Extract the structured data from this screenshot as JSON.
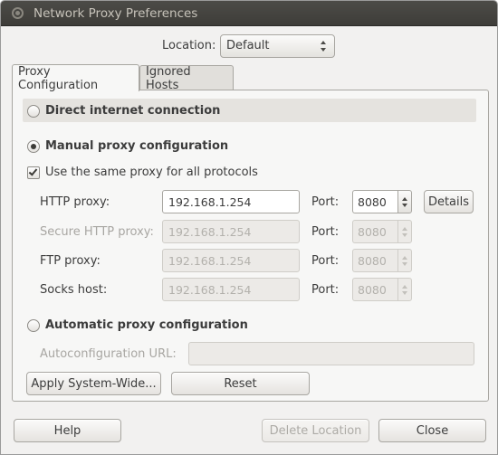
{
  "window": {
    "title": "Network Proxy Preferences"
  },
  "location": {
    "label": "Location:",
    "value": "Default"
  },
  "tabs": [
    {
      "label": "Proxy Configuration"
    },
    {
      "label": "Ignored Hosts"
    }
  ],
  "direct": {
    "label": "Direct internet connection",
    "selected": false
  },
  "manual": {
    "label": "Manual proxy configuration",
    "selected": true,
    "same_proxy": {
      "label": "Use the same proxy for all protocols",
      "checked": true
    },
    "rows": [
      {
        "label": "HTTP proxy:",
        "host": "192.168.1.254",
        "port_label": "Port:",
        "port": "8080",
        "enabled": true
      },
      {
        "label": "Secure HTTP proxy:",
        "host": "192.168.1.254",
        "port_label": "Port:",
        "port": "8080",
        "enabled": false
      },
      {
        "label": "FTP proxy:",
        "host": "192.168.1.254",
        "port_label": "Port:",
        "port": "8080",
        "enabled": false
      },
      {
        "label": "Socks host:",
        "host": "192.168.1.254",
        "port_label": "Port:",
        "port": "8080",
        "enabled": false
      }
    ],
    "details_label": "Details"
  },
  "automatic": {
    "label": "Automatic proxy configuration",
    "selected": false,
    "url_label": "Autoconfiguration URL:",
    "url_value": ""
  },
  "actions": {
    "apply_label": "Apply System-Wide...",
    "reset_label": "Reset"
  },
  "footer": {
    "help_label": "Help",
    "delete_label": "Delete Location",
    "close_label": "Close"
  }
}
